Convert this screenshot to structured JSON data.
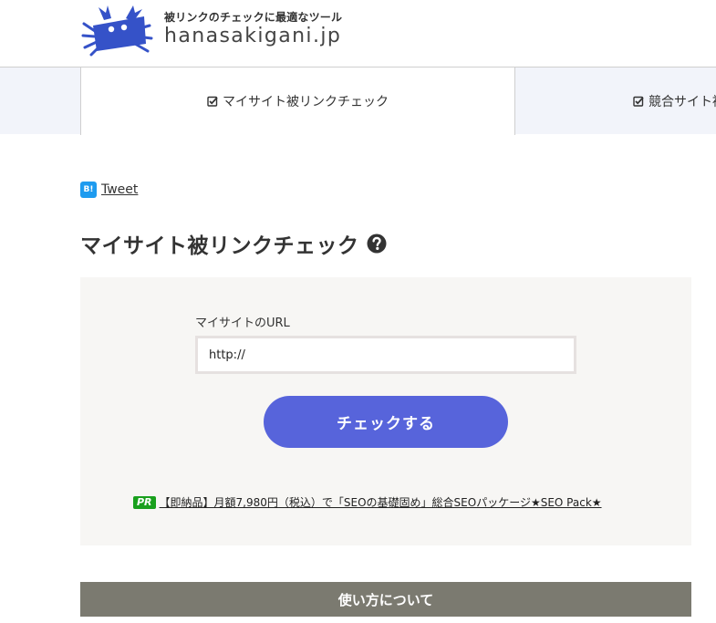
{
  "header": {
    "tagline": "被リンクのチェックに最適なツール",
    "site_name": "hanasakigani.jp",
    "logo_icon": "crab-icon"
  },
  "tabs": [
    {
      "label": "マイサイト被リンクチェック",
      "icon": "check-square-icon",
      "active": true
    },
    {
      "label": "競合サイト被",
      "icon": "check-square-icon",
      "active": false
    }
  ],
  "share": {
    "hatena_label": "B!",
    "tweet_label": "Tweet"
  },
  "page": {
    "title": "マイサイト被リンクチェック",
    "help_icon": "question-circle-icon"
  },
  "form": {
    "url_label": "マイサイトのURL",
    "url_value": "http://",
    "submit_label": "チェックする"
  },
  "pr": {
    "badge": "PR",
    "link_text": "【即納品】月額7,980円（税込）で「SEOの基礎固め」総合SEOパッケージ★SEO Pack★"
  },
  "usage": {
    "label": "使い方について"
  },
  "colors": {
    "button": "#5764db",
    "tab_bar_bg": "#f2f4fa",
    "form_bg": "#f7f6f4",
    "usage_bar": "#7b7a70",
    "pr_badge": "#19a01d",
    "hatena": "#1e9bef",
    "logo_blue": "#3552c8"
  }
}
